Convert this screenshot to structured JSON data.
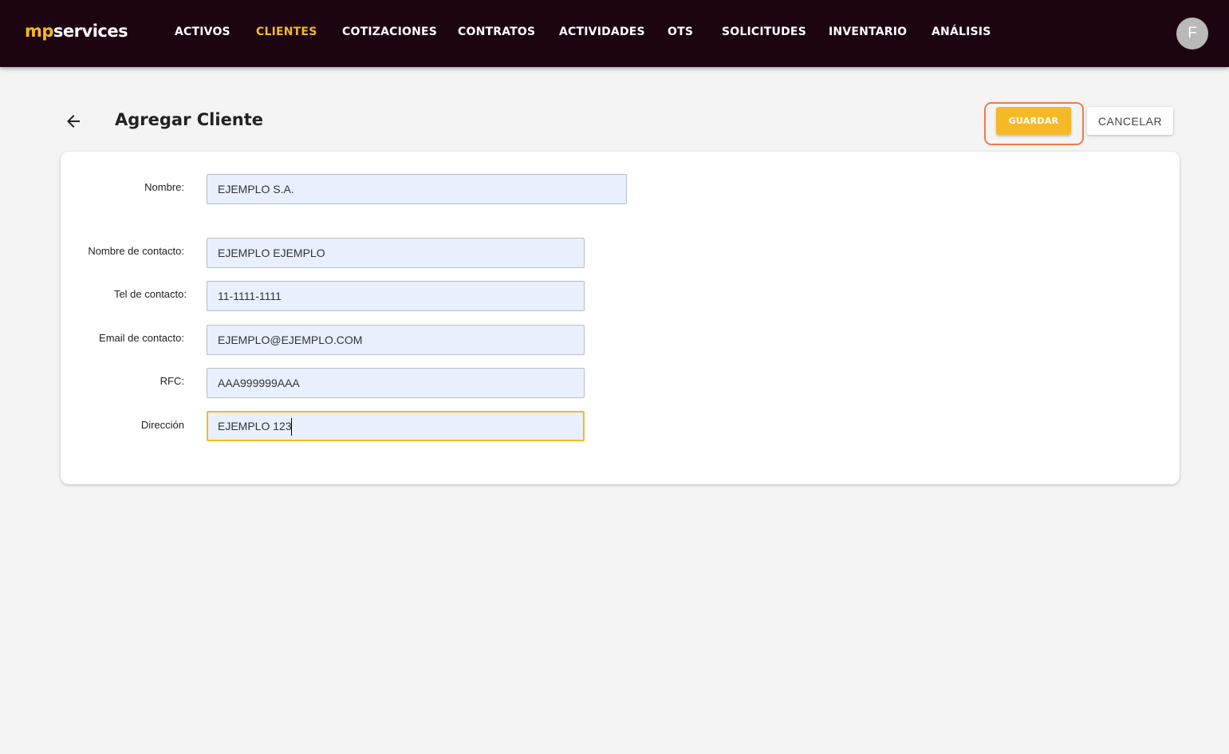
{
  "app": {
    "logo_part1": "mp",
    "logo_part2": "services",
    "accent_color": "#f5b928",
    "nav_bg_color": "#1c0510"
  },
  "nav": {
    "items": [
      {
        "label": "ACTIVOS"
      },
      {
        "label": "CLIENTES",
        "active": true
      },
      {
        "label": "COTIZACIONES"
      },
      {
        "label": "CONTRATOS"
      },
      {
        "label": "ACTIVIDADES"
      },
      {
        "label": "OTS"
      },
      {
        "label": "SOLICITUDES"
      },
      {
        "label": "INVENTARIO"
      },
      {
        "label": "ANÁLISIS"
      }
    ]
  },
  "user": {
    "avatar_initial": "F"
  },
  "header": {
    "back_icon": "arrow-left-icon",
    "title": "Agregar Cliente",
    "save_label": "GUARDAR",
    "cancel_label": "CANCELAR"
  },
  "form": {
    "nombre": {
      "label": "Nombre:",
      "value": "EJEMPLO S.A."
    },
    "nombre_contacto": {
      "label": "Nombre de contacto:",
      "value": "EJEMPLO EJEMPLO"
    },
    "tel_contacto": {
      "label": "Tel de contacto:",
      "value": "11-1111-1111"
    },
    "email_contacto": {
      "label": "Email de contacto:",
      "value": "EJEMPLO@EJEMPLO.COM"
    },
    "rfc": {
      "label": "RFC:",
      "value": "AAA999999AAA"
    },
    "direccion": {
      "label": "Dirección",
      "value": "EJEMPLO 123",
      "focused": true
    }
  }
}
